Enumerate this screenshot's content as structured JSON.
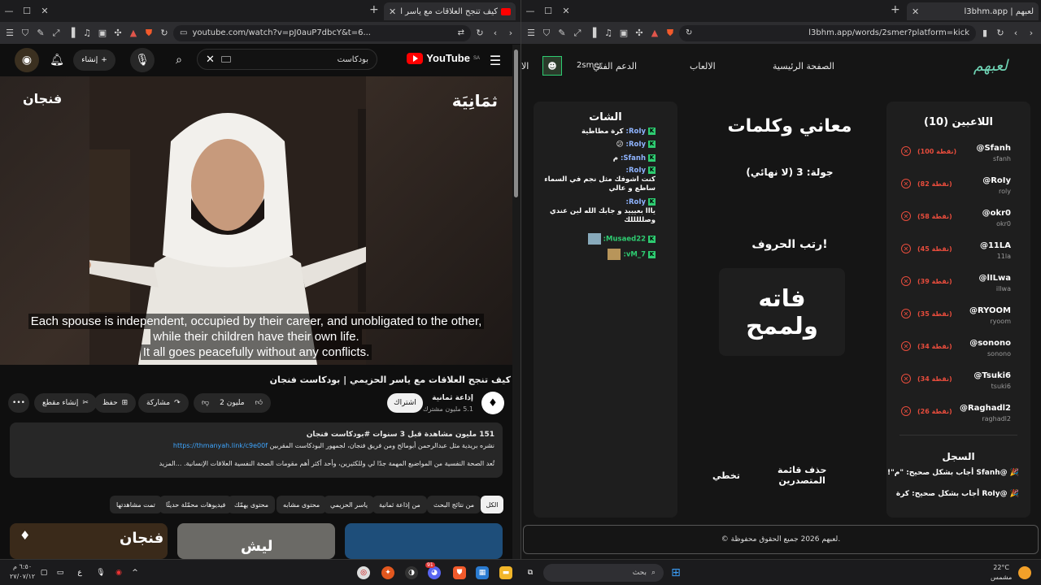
{
  "left_window": {
    "tab_title": "كيف تنجح العلاقات مع ياسر الحز",
    "url": "youtube.com/watch?v=pJ0auP7dbcY&t=6...",
    "youtube": {
      "logo": "YouTube",
      "region": "SA",
      "search_value": "بودكاست",
      "create_label": "إنشاء",
      "brand_right": "ثمَانِيَة",
      "brand_left": "فنجان",
      "subtitle_lines": [
        "Each spouse is independent, occupied by their career, and unobligated to the other,",
        "while their children have their own life.",
        "It all goes peacefully without any conflicts."
      ],
      "video_title": "كيف تنجح العلاقات مع ياسر الحزيمي | بودكاست فنجان",
      "channel_name": "إذاعة ثمانية",
      "subscribers": "5.1 مليون مشترك",
      "subscribe_label": "اشتراك",
      "likes": "2 مليون",
      "share_label": "مشاركة",
      "save_label": "حفظ",
      "clip_label": "إنشاء مقطع",
      "desc_meta": "151 مليون مشاهدة  قبل 3 سنوات  #بودكاست فنجان",
      "desc_line2_a": "نشره بريدية مثل عبدالرحمن أبومالح ومن فريق فنجان، لجمهور البودكاست المقربين",
      "desc_link": "https://thmanyah.link/c9e00f",
      "desc_line3": "تُعد الصحة النفسية من المواضيع المهمة جدًا لي وللكثيرين، وأحد أكثر أهم مقومات الصحة النفسية العلاقات الإنسانية. ...المزيد",
      "chips": [
        "الكل",
        "من نتائج البحث",
        "من إذاعة ثمانية",
        "ياسر الحزيمي",
        "محتوى مشابه",
        "محتوى يهمّك",
        "فيديوهات محمّلة حديثًا",
        "تمت مشاهدتها"
      ],
      "thumb_texts": [
        "فنجان",
        "ليش"
      ]
    }
  },
  "right_window": {
    "tab_title": "لعبهم | l3bhm.app",
    "url": "l3bhm.app/words/2smer?platform=kick",
    "nav": {
      "logo": "لعبهم",
      "home": "الصفحة الرئيسية",
      "games": "الالعاب",
      "support": "الدعم الفني",
      "username": "2smer",
      "cut": "الا"
    },
    "players_title": "اللاعبين (10)",
    "players": [
      {
        "name": "@Sfanh",
        "user": "sfanh",
        "points": "(100 نقطة)"
      },
      {
        "name": "@RoIy",
        "user": "roly",
        "points": "(82 نقطة)"
      },
      {
        "name": "@okr0",
        "user": "okr0",
        "points": "(58 نقطة)"
      },
      {
        "name": "@11LA",
        "user": "11la",
        "points": "(45 نقطة)"
      },
      {
        "name": "@lILwa",
        "user": "illwa",
        "points": "(39 نقطة)"
      },
      {
        "name": "@RYOOM",
        "user": "ryoom",
        "points": "(35 نقطة)"
      },
      {
        "name": "@sonono",
        "user": "sonono",
        "points": "(34 نقطة)"
      },
      {
        "name": "@Tsuki6",
        "user": "tsuki6",
        "points": "(34 نقطة)"
      },
      {
        "name": "@Raghadl2",
        "user": "raghadl2",
        "points": "(26 نقطة)"
      }
    ],
    "game_title": "معاني وكلمات",
    "round": "جولة: 3 (لا نهائي)",
    "instruction": "رتب الحروف!",
    "word_line1": "فاته",
    "word_line2": "ولممح",
    "skip_label": "تخطي",
    "clear_label_1": "حذف قائمة",
    "clear_label_2": "المتصدرين",
    "chat_title": "الشات",
    "chat": [
      {
        "user": "RoIy:",
        "msg": "كرة مطاطية"
      },
      {
        "user": "RoIy:",
        "msg": "😕"
      },
      {
        "user": "Sfanh:",
        "msg": "م"
      },
      {
        "user": "RoIy:",
        "msg": "كنت اشوفك مثل نجم في السماء ساطع و عالي"
      },
      {
        "user": "RoIy:",
        "msg": "يااا بعيييد و جابك الله لين عندي وصلللللك"
      },
      {
        "user": "Musaed22:",
        "msg": ""
      },
      {
        "user": "vM_7:",
        "msg": ""
      }
    ],
    "log_title": "السجل",
    "log": [
      "🎉 @Sfanh أجاب بشكل صحيح: \"م\"!",
      "🎉 @RoIy أجاب بشكل صحيح: كرة"
    ],
    "footer": "© لعبهم 2026 جميع الحقوق محفوظة."
  },
  "taskbar": {
    "search": "بحث",
    "weather_temp": "22°C",
    "weather_desc": "مشمس",
    "time": "٦:٥٠ م",
    "date": "٢٧/٠٧/١٢",
    "lang": "ع",
    "discord_badge": "91"
  }
}
